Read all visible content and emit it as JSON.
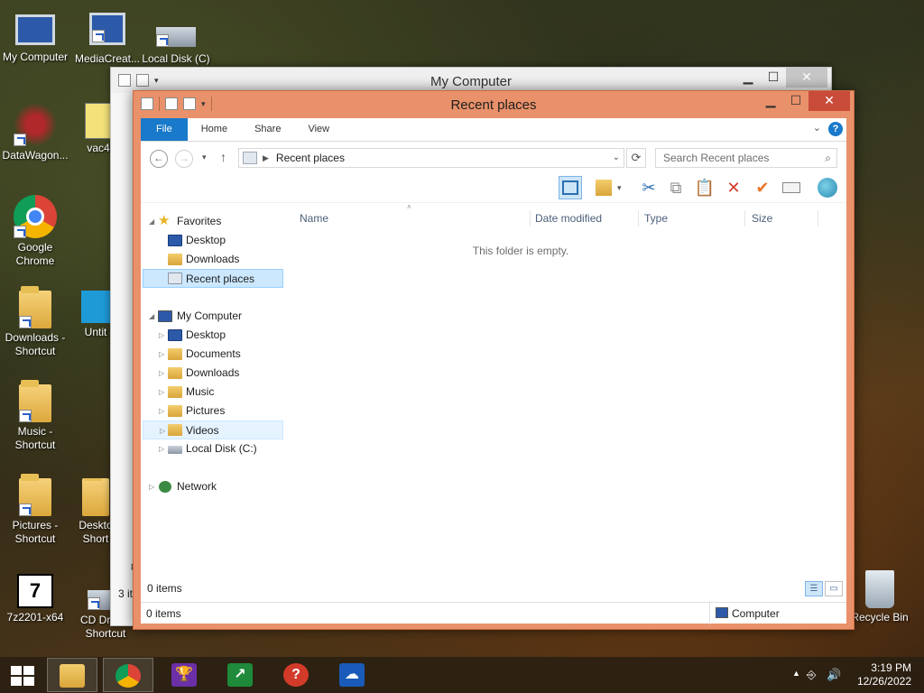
{
  "desktop": {
    "icons": [
      {
        "label": "My Computer"
      },
      {
        "label": "MediaCreat..."
      },
      {
        "label": "Local Disk (C)"
      },
      {
        "label": "DataWagon..."
      },
      {
        "label": "vac4"
      },
      {
        "label": "Google Chrome"
      },
      {
        "label": "Downloads - Shortcut"
      },
      {
        "label": "Untit"
      },
      {
        "label": "Music - Shortcut"
      },
      {
        "label": "Pictures - Shortcut"
      },
      {
        "label": "Deskto Short"
      },
      {
        "label": "7z2201-x64"
      },
      {
        "label": "CD Drive - Shortcut"
      },
      {
        "label": "Recycle Bin"
      }
    ]
  },
  "back_window": {
    "title": "My Computer",
    "status_items": "3 it",
    "minimize": "▁",
    "maximize": "☐",
    "close": "✕",
    "side_digit": "8"
  },
  "window": {
    "title": "Recent places",
    "minimize": "▁",
    "maximize": "☐",
    "close": "✕",
    "ribbon_tabs": [
      "File",
      "Home",
      "Share",
      "View"
    ],
    "address": {
      "location": "Recent places",
      "search_placeholder": "Search Recent places"
    },
    "nav_pane": {
      "favorites": "Favorites",
      "favorites_items": [
        "Desktop",
        "Downloads",
        "Recent places"
      ],
      "my_computer": "My Computer",
      "my_computer_items": [
        "Desktop",
        "Documents",
        "Downloads",
        "Music",
        "Pictures",
        "Videos",
        "Local Disk (C:)"
      ],
      "network": "Network"
    },
    "columns": [
      "Name",
      "Date modified",
      "Type",
      "Size"
    ],
    "empty_message": "This folder is empty.",
    "inner_status": "0 items",
    "outer_status": "0 items",
    "status_zone": "Computer"
  },
  "taskbar": {
    "apps": [
      "File Explorer",
      "Google Chrome",
      "Trophy app",
      "Finance app",
      "Help app",
      "OneDrive"
    ],
    "time": "3:19 PM",
    "date": "12/26/2022"
  },
  "colors": {
    "active_frame": "#e9916a",
    "file_tab": "#1979ca",
    "selection": "#cce8ff",
    "close_button": "#c94b3a"
  }
}
